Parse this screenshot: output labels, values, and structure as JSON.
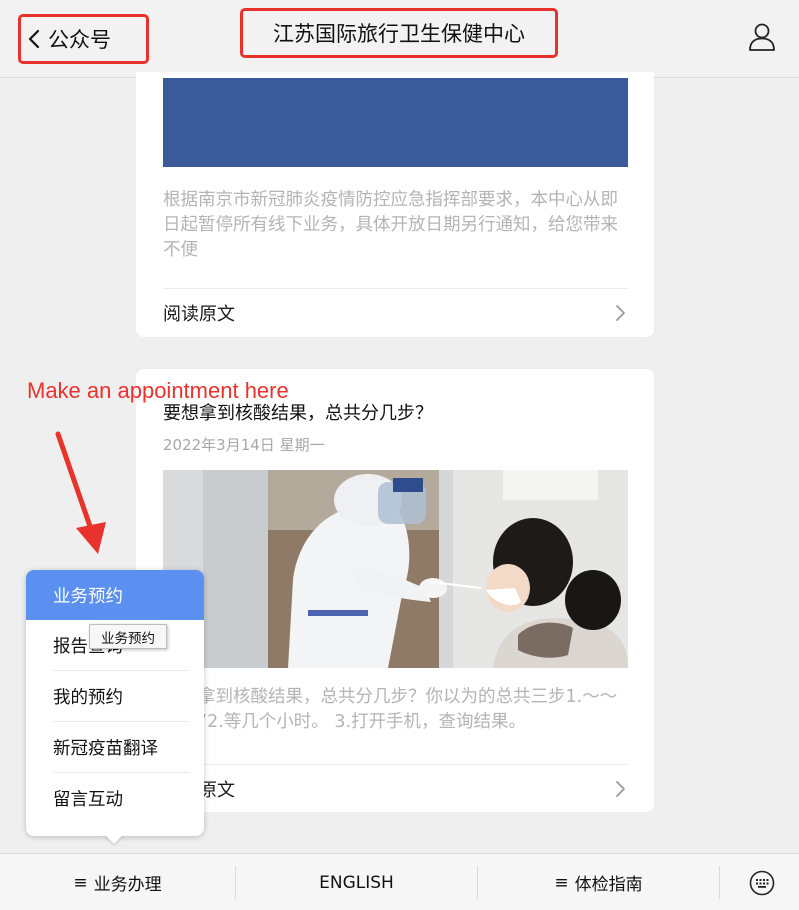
{
  "header": {
    "back_label": "公众号",
    "title": "江苏国际旅行卫生保健中心",
    "profile_icon": "user-profile-icon"
  },
  "feed": {
    "card1": {
      "excerpt": "根据南京市新冠肺炎疫情防控应急指挥部要求，本中心从即日起暂停所有线下业务，具体开放日期另行通知，给您带来不便",
      "read_more": "阅读原文"
    },
    "card2": {
      "title": "要想拿到核酸结果，总共分几步？",
      "date": "2022年3月14日 星期一",
      "excerpt": "要想拿到核酸结果，总共分几步？你以为的总共三步1.～～～～”2.等几个小时。 3.打开手机，查询结果。",
      "read_more": "阅读原文"
    }
  },
  "annotation": {
    "text": "Make an appointment here",
    "color": "#e8322b"
  },
  "menu": {
    "items": [
      {
        "label": "业务预约",
        "active": true
      },
      {
        "label": "报告查询"
      },
      {
        "label": "我的预约"
      },
      {
        "label": "新冠疫苗翻译"
      },
      {
        "label": "留言互动"
      }
    ],
    "tooltip": "业务预约",
    "active_color": "#5b8ff0"
  },
  "bottom_bar": {
    "tabs": [
      {
        "label": "业务办理",
        "icon": "list-menu-icon"
      },
      {
        "label": "ENGLISH"
      },
      {
        "label": "体检指南",
        "icon": "list-menu-icon"
      }
    ],
    "keyboard_icon": "keyboard-icon"
  },
  "colors": {
    "banner": "#3b5a9a",
    "highlight_box": "#e8322b"
  }
}
